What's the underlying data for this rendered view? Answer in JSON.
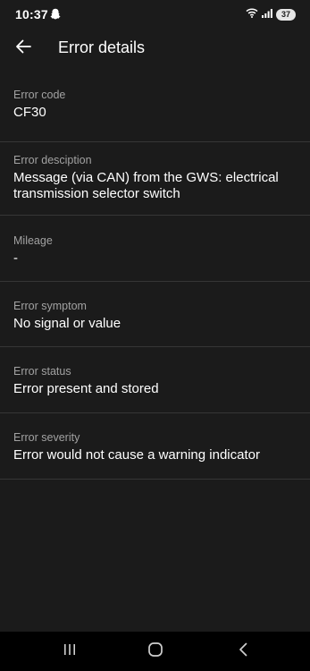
{
  "status_bar": {
    "time": "10:37",
    "battery": "37"
  },
  "app_bar": {
    "title": "Error details"
  },
  "details": [
    {
      "label": "Error code",
      "value": "CF30"
    },
    {
      "label": "Error desciption",
      "value": "Message (via CAN) from the GWS: electrical transmission selector switch"
    },
    {
      "label": "Mileage",
      "value": "-"
    },
    {
      "label": "Error symptom",
      "value": "No signal or value"
    },
    {
      "label": "Error status",
      "value": "Error present and stored"
    },
    {
      "label": "Error severity",
      "value": "Error would not cause a warning indicator"
    }
  ],
  "icons": {
    "back": "arrow-back-icon",
    "ghost": "snapchat-ghost-icon",
    "wifi": "wifi-icon",
    "signal": "signal-icon",
    "recents": "recents-icon",
    "home": "home-icon",
    "nav_back": "nav-back-icon"
  },
  "colors": {
    "background": "#1b1b1b",
    "divider": "#363636",
    "label": "#a2a2a2",
    "text": "#ffffff",
    "nav_bar": "#000000"
  }
}
